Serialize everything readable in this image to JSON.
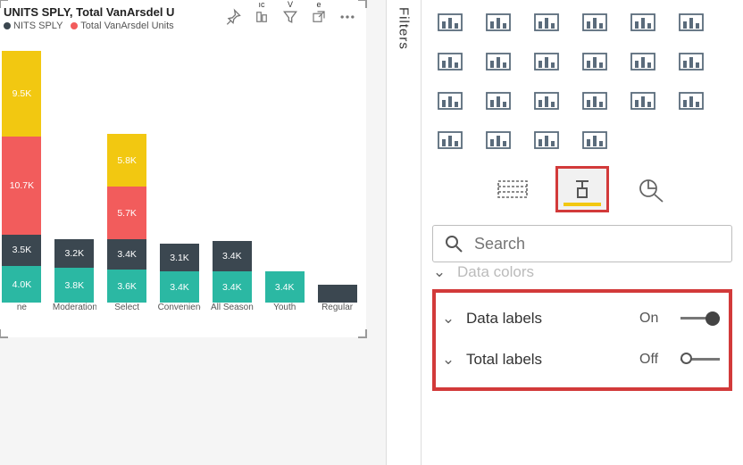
{
  "chart": {
    "title": "UNITS SPLY, Total VanArsdel U",
    "legend_sply": "NITS SPLY",
    "legend_van": "Total VanArsdel Units",
    "header_mini_1": "ıc",
    "header_mini_2": "V",
    "header_mini_3": "e"
  },
  "chart_data": {
    "type": "bar",
    "stacked": true,
    "categories": [
      "ne",
      "Moderation",
      "Select",
      "Convenience",
      "All Season",
      "Youth",
      "Regular"
    ],
    "series": [
      {
        "name": "teal",
        "color": "#2bb8a3",
        "values": [
          4.0,
          3.8,
          3.6,
          3.4,
          3.4,
          3.4,
          null
        ]
      },
      {
        "name": "dark",
        "color": "#3b4750",
        "values": [
          3.5,
          3.2,
          3.4,
          3.1,
          3.4,
          null,
          null
        ]
      },
      {
        "name": "red",
        "color": "#f25c5c",
        "values": [
          10.7,
          null,
          5.7,
          null,
          null,
          null,
          null
        ]
      },
      {
        "name": "yellow",
        "color": "#f2c811",
        "values": [
          9.5,
          null,
          5.8,
          null,
          null,
          null,
          null
        ]
      }
    ],
    "label_suffix": "K",
    "regular_height_k": 2.0
  },
  "filters_label": "Filters",
  "viz_icons": [
    "stacked-bar-chart-icon",
    "funnel-chart-icon",
    "scatter-chart-icon",
    "pie-chart-icon",
    "donut-chart-icon",
    "treemap-icon",
    "map-icon",
    "filled-map-icon",
    "azure-map-icon",
    "gauge-icon",
    "card-icon",
    "multi-row-card-icon",
    "kpi-icon",
    "slicer-icon",
    "table-icon",
    "matrix-icon",
    "r-visual-icon",
    "decomposition-tree-icon",
    "qa-icon",
    "key-influencers-icon",
    "arcgis-icon",
    "power-apps-icon"
  ],
  "tabs": {
    "fields": "fields-tab",
    "format": "format-tab",
    "analytics": "analytics-tab"
  },
  "search_placeholder": "Search",
  "props": {
    "data_colors": {
      "label": "Data colors"
    },
    "data_labels": {
      "label": "Data labels",
      "state": "On"
    },
    "total_labels": {
      "label": "Total labels",
      "state": "Off"
    }
  }
}
